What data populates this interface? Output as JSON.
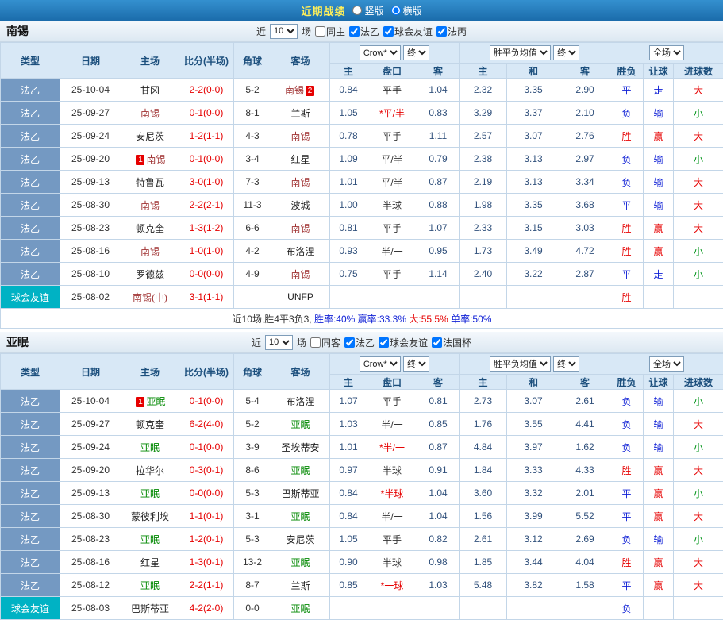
{
  "top_bar": {
    "title": "近期战绩",
    "options": [
      {
        "label": "竖版",
        "selected": false
      },
      {
        "label": "横版",
        "selected": true
      }
    ]
  },
  "table_header": {
    "columns": [
      "类型",
      "日期",
      "主场",
      "比分(半场)",
      "角球",
      "客场"
    ],
    "company_select": "Crow*",
    "stage_select": "终",
    "avg_select": "胜平负均值",
    "avg_stage_select": "终",
    "scope_select": "全场",
    "sub_columns": [
      "主",
      "盘口",
      "客",
      "主",
      "和",
      "客",
      "胜负",
      "让球",
      "进球数"
    ]
  },
  "colors": {
    "topbar_bg": "#2177b8",
    "topbar_title": "#ffef5a",
    "league_cell_bg": "#7499c2",
    "friendly_cell_bg": "#00b2c4",
    "score_text": "#e60000",
    "home_focus_team": "#a03333",
    "away_focus_team": "#008800",
    "result_red": "#e60000",
    "result_blue": "#1021d6",
    "result_green": "#009418"
  },
  "sections": [
    {
      "team": "南锡",
      "filter": {
        "near_label": "近",
        "count": "10",
        "games_label": "场",
        "checkboxes": [
          {
            "label": "同主",
            "checked": false
          },
          {
            "label": "法乙",
            "checked": true
          },
          {
            "label": "球会友谊",
            "checked": true
          },
          {
            "label": "法丙",
            "checked": true
          }
        ]
      },
      "rows": [
        {
          "type": "法乙",
          "date": "25-10-04",
          "home": {
            "name": "甘冈"
          },
          "score": "2-2(0-0)",
          "corner": "5-2",
          "away": {
            "name": "南锡",
            "focus": true,
            "badge_post": "2"
          },
          "odds": [
            "0.84",
            "平手",
            "1.04",
            "2.32",
            "3.35",
            "2.90"
          ],
          "results": [
            "平",
            "走",
            "大"
          ]
        },
        {
          "type": "法乙",
          "date": "25-09-27",
          "home": {
            "name": "南锡",
            "focus": true
          },
          "score": "0-1(0-0)",
          "corner": "8-1",
          "away": {
            "name": "兰斯"
          },
          "odds": [
            "1.05",
            "*平/半",
            "0.83",
            "3.29",
            "3.37",
            "2.10"
          ],
          "results": [
            "负",
            "输",
            "小"
          ]
        },
        {
          "type": "法乙",
          "date": "25-09-24",
          "home": {
            "name": "安尼茨"
          },
          "score": "1-2(1-1)",
          "corner": "4-3",
          "away": {
            "name": "南锡",
            "focus": true
          },
          "odds": [
            "0.78",
            "平手",
            "1.11",
            "2.57",
            "3.07",
            "2.76"
          ],
          "results": [
            "胜",
            "赢",
            "大"
          ]
        },
        {
          "type": "法乙",
          "date": "25-09-20",
          "home": {
            "name": "南锡",
            "focus": true,
            "badge_pre": "1"
          },
          "score": "0-1(0-0)",
          "corner": "3-4",
          "away": {
            "name": "红星"
          },
          "odds": [
            "1.09",
            "平/半",
            "0.79",
            "2.38",
            "3.13",
            "2.97"
          ],
          "results": [
            "负",
            "输",
            "小"
          ]
        },
        {
          "type": "法乙",
          "date": "25-09-13",
          "home": {
            "name": "特鲁瓦"
          },
          "score": "3-0(1-0)",
          "corner": "7-3",
          "away": {
            "name": "南锡",
            "focus": true
          },
          "odds": [
            "1.01",
            "平/半",
            "0.87",
            "2.19",
            "3.13",
            "3.34"
          ],
          "results": [
            "负",
            "输",
            "大"
          ]
        },
        {
          "type": "法乙",
          "date": "25-08-30",
          "home": {
            "name": "南锡",
            "focus": true
          },
          "score": "2-2(2-1)",
          "corner": "11-3",
          "away": {
            "name": "波城"
          },
          "odds": [
            "1.00",
            "半球",
            "0.88",
            "1.98",
            "3.35",
            "3.68"
          ],
          "results": [
            "平",
            "输",
            "大"
          ]
        },
        {
          "type": "法乙",
          "date": "25-08-23",
          "home": {
            "name": "顿克奎"
          },
          "score": "1-3(1-2)",
          "corner": "6-6",
          "away": {
            "name": "南锡",
            "focus": true
          },
          "odds": [
            "0.81",
            "平手",
            "1.07",
            "2.33",
            "3.15",
            "3.03"
          ],
          "results": [
            "胜",
            "赢",
            "大"
          ]
        },
        {
          "type": "法乙",
          "date": "25-08-16",
          "home": {
            "name": "南锡",
            "focus": true
          },
          "score": "1-0(1-0)",
          "corner": "4-2",
          "away": {
            "name": "布洛涅"
          },
          "odds": [
            "0.93",
            "半/一",
            "0.95",
            "1.73",
            "3.49",
            "4.72"
          ],
          "results": [
            "胜",
            "赢",
            "小"
          ]
        },
        {
          "type": "法乙",
          "date": "25-08-10",
          "home": {
            "name": "罗德兹"
          },
          "score": "0-0(0-0)",
          "corner": "4-9",
          "away": {
            "name": "南锡",
            "focus": true
          },
          "odds": [
            "0.75",
            "平手",
            "1.14",
            "2.40",
            "3.22",
            "2.87"
          ],
          "results": [
            "平",
            "走",
            "小"
          ]
        },
        {
          "type": "球会友谊",
          "date": "25-08-02",
          "home": {
            "name": "南锡(中)",
            "focus": true
          },
          "score": "3-1(1-1)",
          "corner": "",
          "away": {
            "name": "UNFP"
          },
          "odds": [
            "",
            "",
            "",
            "",
            "",
            ""
          ],
          "results": [
            "胜",
            "",
            ""
          ]
        }
      ],
      "summary": [
        {
          "t": "近10场,胜4平3负3, ",
          "c": "d"
        },
        {
          "t": "胜率:40% ",
          "c": "blue"
        },
        {
          "t": "赢率:33.3% ",
          "c": "blue"
        },
        {
          "t": "大:55.5% ",
          "c": "red"
        },
        {
          "t": "单率:50%",
          "c": "blue"
        }
      ]
    },
    {
      "team": "亚眠",
      "filter": {
        "near_label": "近",
        "count": "10",
        "games_label": "场",
        "checkboxes": [
          {
            "label": "同客",
            "checked": false
          },
          {
            "label": "法乙",
            "checked": true
          },
          {
            "label": "球会友谊",
            "checked": true
          },
          {
            "label": "法国杯",
            "checked": true
          }
        ]
      },
      "rows": [
        {
          "type": "法乙",
          "date": "25-10-04",
          "home": {
            "name": "亚眠",
            "focus": true,
            "badge_pre": "1"
          },
          "score": "0-1(0-0)",
          "corner": "5-4",
          "away": {
            "name": "布洛涅"
          },
          "odds": [
            "1.07",
            "平手",
            "0.81",
            "2.73",
            "3.07",
            "2.61"
          ],
          "results": [
            "负",
            "输",
            "小"
          ]
        },
        {
          "type": "法乙",
          "date": "25-09-27",
          "home": {
            "name": "顿克奎"
          },
          "score": "6-2(4-0)",
          "corner": "5-2",
          "away": {
            "name": "亚眠",
            "focus": true
          },
          "odds": [
            "1.03",
            "半/一",
            "0.85",
            "1.76",
            "3.55",
            "4.41"
          ],
          "results": [
            "负",
            "输",
            "大"
          ]
        },
        {
          "type": "法乙",
          "date": "25-09-24",
          "home": {
            "name": "亚眠",
            "focus": true
          },
          "score": "0-1(0-0)",
          "corner": "3-9",
          "away": {
            "name": "圣埃蒂安"
          },
          "odds": [
            "1.01",
            "*半/一",
            "0.87",
            "4.84",
            "3.97",
            "1.62"
          ],
          "results": [
            "负",
            "输",
            "小"
          ]
        },
        {
          "type": "法乙",
          "date": "25-09-20",
          "home": {
            "name": "拉华尔"
          },
          "score": "0-3(0-1)",
          "corner": "8-6",
          "away": {
            "name": "亚眠",
            "focus": true
          },
          "odds": [
            "0.97",
            "半球",
            "0.91",
            "1.84",
            "3.33",
            "4.33"
          ],
          "results": [
            "胜",
            "赢",
            "大"
          ]
        },
        {
          "type": "法乙",
          "date": "25-09-13",
          "home": {
            "name": "亚眠",
            "focus": true
          },
          "score": "0-0(0-0)",
          "corner": "5-3",
          "away": {
            "name": "巴斯蒂亚"
          },
          "odds": [
            "0.84",
            "*半球",
            "1.04",
            "3.60",
            "3.32",
            "2.01"
          ],
          "results": [
            "平",
            "赢",
            "小"
          ]
        },
        {
          "type": "法乙",
          "date": "25-08-30",
          "home": {
            "name": "蒙彼利埃"
          },
          "score": "1-1(0-1)",
          "corner": "3-1",
          "away": {
            "name": "亚眠",
            "focus": true
          },
          "odds": [
            "0.84",
            "半/一",
            "1.04",
            "1.56",
            "3.99",
            "5.52"
          ],
          "results": [
            "平",
            "赢",
            "大"
          ]
        },
        {
          "type": "法乙",
          "date": "25-08-23",
          "home": {
            "name": "亚眠",
            "focus": true
          },
          "score": "1-2(0-1)",
          "corner": "5-3",
          "away": {
            "name": "安尼茨"
          },
          "odds": [
            "1.05",
            "平手",
            "0.82",
            "2.61",
            "3.12",
            "2.69"
          ],
          "results": [
            "负",
            "输",
            "小"
          ]
        },
        {
          "type": "法乙",
          "date": "25-08-16",
          "home": {
            "name": "红星"
          },
          "score": "1-3(0-1)",
          "corner": "13-2",
          "away": {
            "name": "亚眠",
            "focus": true
          },
          "odds": [
            "0.90",
            "半球",
            "0.98",
            "1.85",
            "3.44",
            "4.04"
          ],
          "results": [
            "胜",
            "赢",
            "大"
          ]
        },
        {
          "type": "法乙",
          "date": "25-08-12",
          "home": {
            "name": "亚眠",
            "focus": true
          },
          "score": "2-2(1-1)",
          "corner": "8-7",
          "away": {
            "name": "兰斯"
          },
          "odds": [
            "0.85",
            "*一球",
            "1.03",
            "5.48",
            "3.82",
            "1.58"
          ],
          "results": [
            "平",
            "赢",
            "大"
          ]
        },
        {
          "type": "球会友谊",
          "date": "25-08-03",
          "home": {
            "name": "巴斯蒂亚"
          },
          "score": "4-2(2-0)",
          "corner": "0-0",
          "away": {
            "name": "亚眠",
            "focus": true
          },
          "odds": [
            "",
            "",
            "",
            "",
            "",
            ""
          ],
          "results": [
            "负",
            "",
            ""
          ]
        }
      ]
    }
  ]
}
